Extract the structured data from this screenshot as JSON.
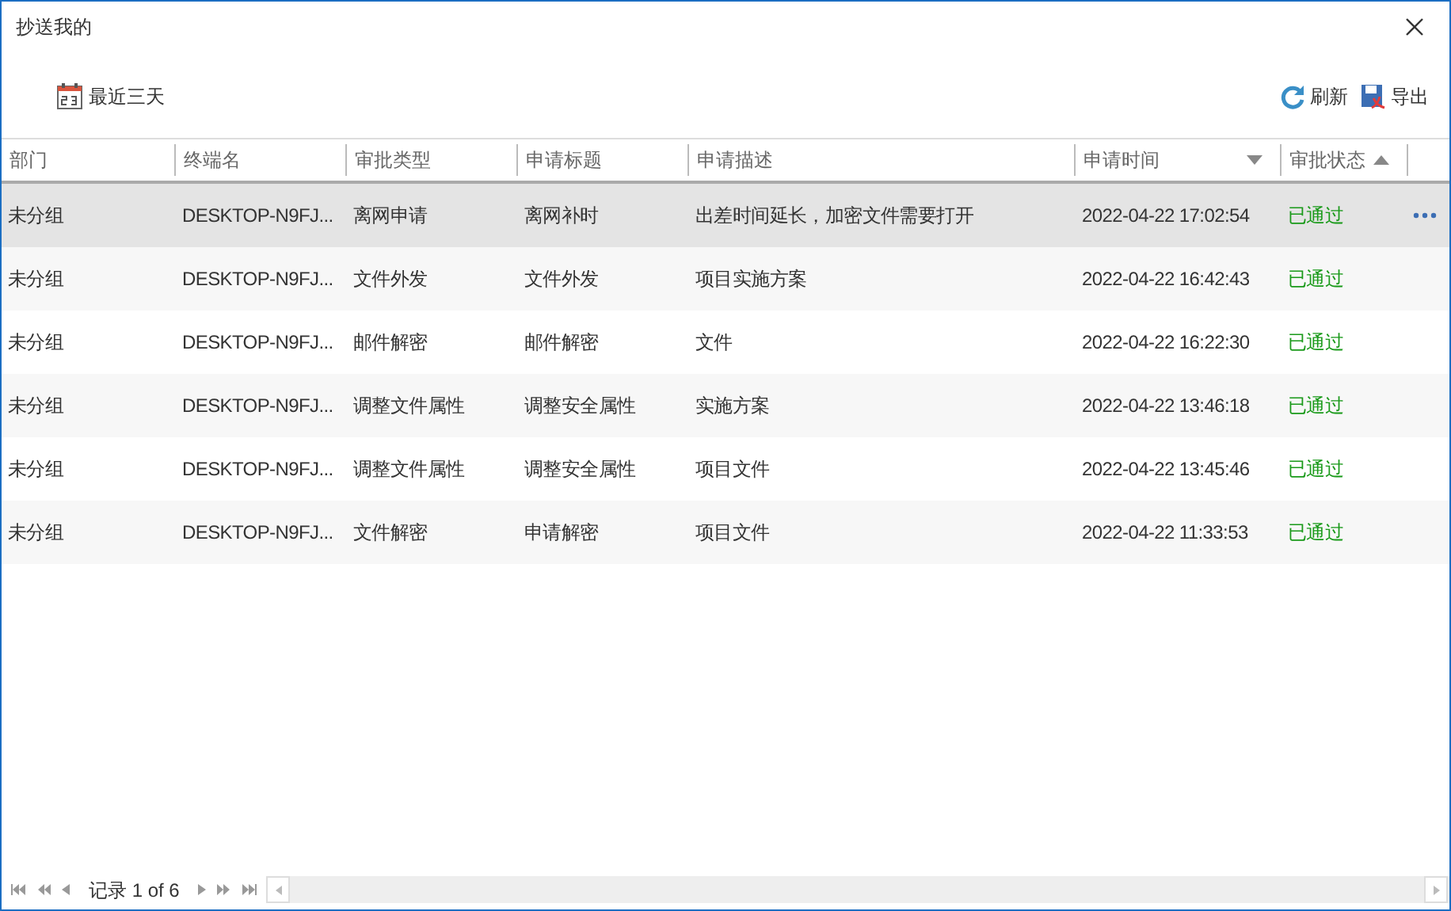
{
  "window": {
    "title": "抄送我的"
  },
  "toolbar": {
    "left": [
      {
        "kind": "calendar",
        "label": "最近三天"
      }
    ],
    "right": [
      {
        "kind": "refresh",
        "label": "刷新"
      },
      {
        "kind": "export",
        "label": "导出"
      }
    ]
  },
  "table": {
    "columns": [
      {
        "label": "部门",
        "sort_descending": false,
        "sort_ascending": false
      },
      {
        "label": "终端名",
        "sort_descending": false,
        "sort_ascending": false
      },
      {
        "label": "审批类型",
        "sort_descending": false,
        "sort_ascending": false
      },
      {
        "label": "申请标题",
        "sort_descending": false,
        "sort_ascending": false
      },
      {
        "label": "申请描述",
        "sort_descending": false,
        "sort_ascending": false
      },
      {
        "label": "申请时间",
        "sort_descending": true,
        "sort_ascending": false
      },
      {
        "label": "审批状态",
        "sort_descending": false,
        "sort_ascending": true
      }
    ],
    "rows": [
      {
        "selected": true,
        "cells": [
          "未分组",
          "DESKTOP-N9FJ...",
          "离网申请",
          "离网补时",
          "出差时间延长，加密文件需要打开",
          "2022-04-22 17:02:54",
          "已通过"
        ]
      },
      {
        "selected": false,
        "cells": [
          "未分组",
          "DESKTOP-N9FJ...",
          "文件外发",
          "文件外发",
          "项目实施方案",
          "2022-04-22 16:42:43",
          "已通过"
        ]
      },
      {
        "selected": false,
        "cells": [
          "未分组",
          "DESKTOP-N9FJ...",
          "邮件解密",
          "邮件解密",
          "文件",
          "2022-04-22 16:22:30",
          "已通过"
        ]
      },
      {
        "selected": false,
        "cells": [
          "未分组",
          "DESKTOP-N9FJ...",
          "调整文件属性",
          "调整安全属性",
          "实施方案",
          "2022-04-22 13:46:18",
          "已通过"
        ]
      },
      {
        "selected": false,
        "cells": [
          "未分组",
          "DESKTOP-N9FJ...",
          "调整文件属性",
          "调整安全属性",
          "项目文件",
          "2022-04-22 13:45:46",
          "已通过"
        ]
      },
      {
        "selected": false,
        "cells": [
          "未分组",
          "DESKTOP-N9FJ...",
          "文件解密",
          "申请解密",
          "项目文件",
          "2022-04-22 11:33:53",
          "已通过"
        ]
      }
    ]
  },
  "pager": {
    "label": "记录 1 of 6"
  }
}
